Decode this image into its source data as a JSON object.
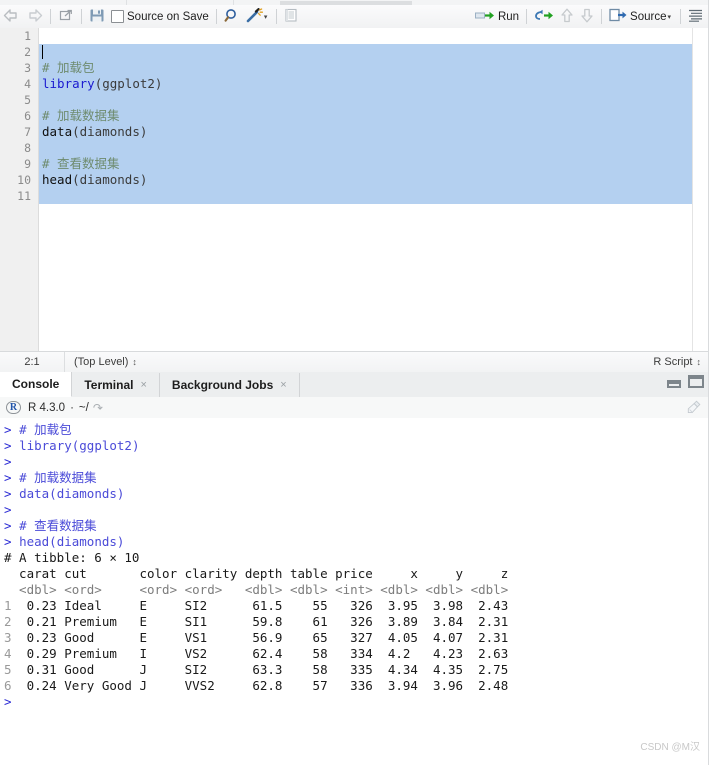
{
  "source_toolbar": {
    "back_icon": "back-arrow-icon",
    "forward_icon": "forward-arrow-icon",
    "popout_icon": "show-in-new-window-icon",
    "save_icon": "save-icon",
    "source_on_save_label": "Source on Save",
    "find_icon": "magnifier-icon",
    "magic_icon": "code-tools-wand-icon",
    "magic_dropdown": "▾",
    "compile_report_icon": "compile-report-icon",
    "run_label": "Run",
    "run_icon": "run-icon",
    "rerun_icon": "rerun-previous-icon",
    "up_icon": "chunk-up-icon",
    "down_icon": "chunk-down-icon",
    "source_label": "Source",
    "source_icon": "source-icon",
    "source_dropdown": "▾",
    "outline_icon": "document-outline-icon"
  },
  "editor": {
    "line_numbers": [
      "1",
      "2",
      "3",
      "4",
      "5",
      "6",
      "7",
      "8",
      "9",
      "10",
      "11"
    ],
    "lines": [
      {
        "n": 1,
        "segments": []
      },
      {
        "n": 2,
        "segments": []
      },
      {
        "n": 3,
        "segments": [
          {
            "t": "# 加载包",
            "c": "cm"
          }
        ]
      },
      {
        "n": 4,
        "segments": [
          {
            "t": "library",
            "c": "kw"
          },
          {
            "t": "(ggplot2)",
            "c": "pn"
          }
        ]
      },
      {
        "n": 5,
        "segments": []
      },
      {
        "n": 6,
        "segments": [
          {
            "t": "# 加载数据集",
            "c": "cm"
          }
        ]
      },
      {
        "n": 7,
        "segments": [
          {
            "t": "data",
            "c": "txt"
          },
          {
            "t": "(diamonds)",
            "c": "pn"
          }
        ]
      },
      {
        "n": 8,
        "segments": []
      },
      {
        "n": 9,
        "segments": [
          {
            "t": "# 查看数据集",
            "c": "cm"
          }
        ]
      },
      {
        "n": 10,
        "segments": [
          {
            "t": "head",
            "c": "txt"
          },
          {
            "t": "(diamonds)",
            "c": "pn"
          }
        ]
      },
      {
        "n": 11,
        "segments": []
      }
    ]
  },
  "source_status": {
    "cursor_position": "2:1",
    "scope": "(Top Level)",
    "scope_stepper": "↕",
    "file_type": "R Script",
    "file_type_stepper": "↕"
  },
  "console_panel": {
    "tabs": [
      {
        "label": "Console",
        "closable": false,
        "active": true
      },
      {
        "label": "Terminal",
        "closable": true,
        "active": false
      },
      {
        "label": "Background Jobs",
        "closable": true,
        "active": false
      }
    ],
    "close_glyph": "×",
    "minimize_icon": "minimize-pane-icon",
    "maximize_icon": "maximize-pane-icon",
    "r_logo": "R",
    "r_version": "R 4.3.0",
    "separator": "·",
    "working_dir": "~/",
    "popout_icon": "open-in-window-icon",
    "clear_console_icon": "broom-clear-console-icon"
  },
  "console_output": {
    "lines": [
      {
        "kind": "input",
        "prompt": "> ",
        "text": "# 加载包"
      },
      {
        "kind": "input",
        "prompt": "> ",
        "text": "library(ggplot2)"
      },
      {
        "kind": "input",
        "prompt": "> ",
        "text": ""
      },
      {
        "kind": "input",
        "prompt": "> ",
        "text": "# 加载数据集"
      },
      {
        "kind": "input",
        "prompt": "> ",
        "text": "data(diamonds)"
      },
      {
        "kind": "input",
        "prompt": "> ",
        "text": ""
      },
      {
        "kind": "input",
        "prompt": "> ",
        "text": "# 查看数据集"
      },
      {
        "kind": "input",
        "prompt": "> ",
        "text": "head(diamonds)"
      },
      {
        "kind": "output",
        "text": "# A tibble: 6 × 10"
      },
      {
        "kind": "header",
        "text": "  carat cut       color clarity depth table price     x     y     z"
      },
      {
        "kind": "types",
        "text": "  <dbl> <ord>     <ord> <ord>   <dbl> <dbl> <int> <dbl> <dbl> <dbl>"
      },
      {
        "kind": "row",
        "text": "1  0.23 Ideal     E     SI2      61.5    55   326  3.95  3.98  2.43"
      },
      {
        "kind": "row",
        "text": "2  0.21 Premium   E     SI1      59.8    61   326  3.89  3.84  2.31"
      },
      {
        "kind": "row",
        "text": "3  0.23 Good      E     VS1      56.9    65   327  4.05  4.07  2.31"
      },
      {
        "kind": "row",
        "text": "4  0.29 Premium   I     VS2      62.4    58   334  4.2   4.23  2.63"
      },
      {
        "kind": "row",
        "text": "5  0.31 Good      J     SI2      63.3    58   335  4.34  4.35  2.75"
      },
      {
        "kind": "row",
        "text": "6  0.24 Very Good J     VVS2     62.8    57   336  3.94  3.96  2.48"
      },
      {
        "kind": "input",
        "prompt": "> ",
        "text": ""
      }
    ],
    "tibble_summary": {
      "rows": 6,
      "cols": 10,
      "columns": [
        "carat",
        "cut",
        "color",
        "clarity",
        "depth",
        "table",
        "price",
        "x",
        "y",
        "z"
      ],
      "types": [
        "<dbl>",
        "<ord>",
        "<ord>",
        "<ord>",
        "<dbl>",
        "<dbl>",
        "<int>",
        "<dbl>",
        "<dbl>",
        "<dbl>"
      ],
      "data": [
        [
          "0.23",
          "Ideal",
          "E",
          "SI2",
          "61.5",
          "55",
          "326",
          "3.95",
          "3.98",
          "2.43"
        ],
        [
          "0.21",
          "Premium",
          "E",
          "SI1",
          "59.8",
          "61",
          "326",
          "3.89",
          "3.84",
          "2.31"
        ],
        [
          "0.23",
          "Good",
          "E",
          "VS1",
          "56.9",
          "65",
          "327",
          "4.05",
          "4.07",
          "2.31"
        ],
        [
          "0.29",
          "Premium",
          "I",
          "VS2",
          "62.4",
          "58",
          "334",
          "4.2",
          "4.23",
          "2.63"
        ],
        [
          "0.31",
          "Good",
          "J",
          "SI2",
          "63.3",
          "58",
          "335",
          "4.34",
          "4.35",
          "2.75"
        ],
        [
          "0.24",
          "Very Good",
          "J",
          "VVS2",
          "62.8",
          "57",
          "336",
          "3.94",
          "3.96",
          "2.48"
        ]
      ]
    }
  },
  "watermark": {
    "text": "CSDN @M汉"
  },
  "colors": {
    "selection": "#b4d0f0",
    "keyword_blue": "#1a1ad0",
    "comment_green": "#6e8b6e",
    "console_input_blue": "#4b4bd8",
    "run_green": "#21a121"
  }
}
